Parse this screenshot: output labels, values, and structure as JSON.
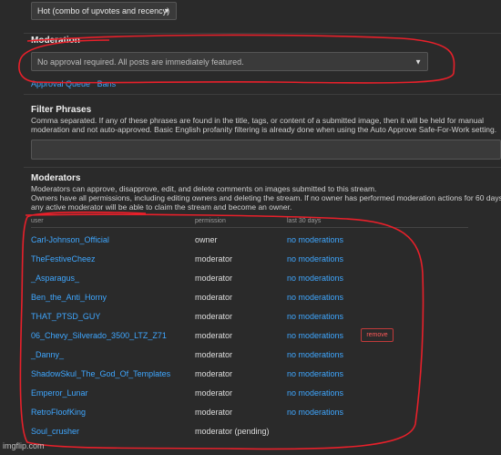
{
  "sort": {
    "selected": "Hot (combo of upvotes and recency)"
  },
  "moderation": {
    "title": "Moderation",
    "approval_selected": "No approval required. All posts are immediately featured.",
    "approval_queue_link": "Approval Queue",
    "bans_link": "Bans"
  },
  "filter": {
    "title": "Filter Phrases",
    "desc_line1": "Comma separated. If any of these phrases are found in the title, tags, or content of a submitted image, then it will be held for manual",
    "desc_line2": "moderation and not auto-approved. Basic English profanity filtering is already done when using the Auto Approve Safe-For-Work setting.",
    "value": ""
  },
  "moderators": {
    "title": "Moderators",
    "desc_line1": "Moderators can approve, disapprove, edit, and delete comments on images submitted to this stream.",
    "desc_line2": "Owners have all permissions, including editing owners and deleting the stream. If no owner has performed moderation actions for 60 days,",
    "desc_line3": "any active moderator will be able to claim the stream and become an owner.",
    "columns": {
      "user": "user",
      "permission": "permission",
      "last30": "last 30 days"
    },
    "remove_label": "remove",
    "rows": [
      {
        "user": "Carl-Johnson_Official",
        "permission": "owner",
        "activity": "no moderations"
      },
      {
        "user": "TheFestiveCheez",
        "permission": "moderator",
        "activity": "no moderations"
      },
      {
        "user": "_Asparagus_",
        "permission": "moderator",
        "activity": "no moderations"
      },
      {
        "user": "Ben_the_Anti_Horny",
        "permission": "moderator",
        "activity": "no moderations"
      },
      {
        "user": "THAT_PTSD_GUY",
        "permission": "moderator",
        "activity": "no moderations"
      },
      {
        "user": "06_Chevy_Silverado_3500_LTZ_Z71",
        "permission": "moderator",
        "activity": "no moderations"
      },
      {
        "user": "_Danny_",
        "permission": "moderator",
        "activity": "no moderations"
      },
      {
        "user": "ShadowSkul_The_God_Of_Templates",
        "permission": "moderator",
        "activity": "no moderations"
      },
      {
        "user": "Emperor_Lunar",
        "permission": "moderator",
        "activity": "no moderations"
      },
      {
        "user": "RetroFloofKing",
        "permission": "moderator",
        "activity": "no moderations"
      },
      {
        "user": "Soul_crusher",
        "permission": "moderator (pending)",
        "activity": ""
      }
    ]
  },
  "watermark": "imgflip.com",
  "colors": {
    "link": "#3fa7ff",
    "annotation": "#e8202a",
    "background": "#2a2a2a"
  }
}
